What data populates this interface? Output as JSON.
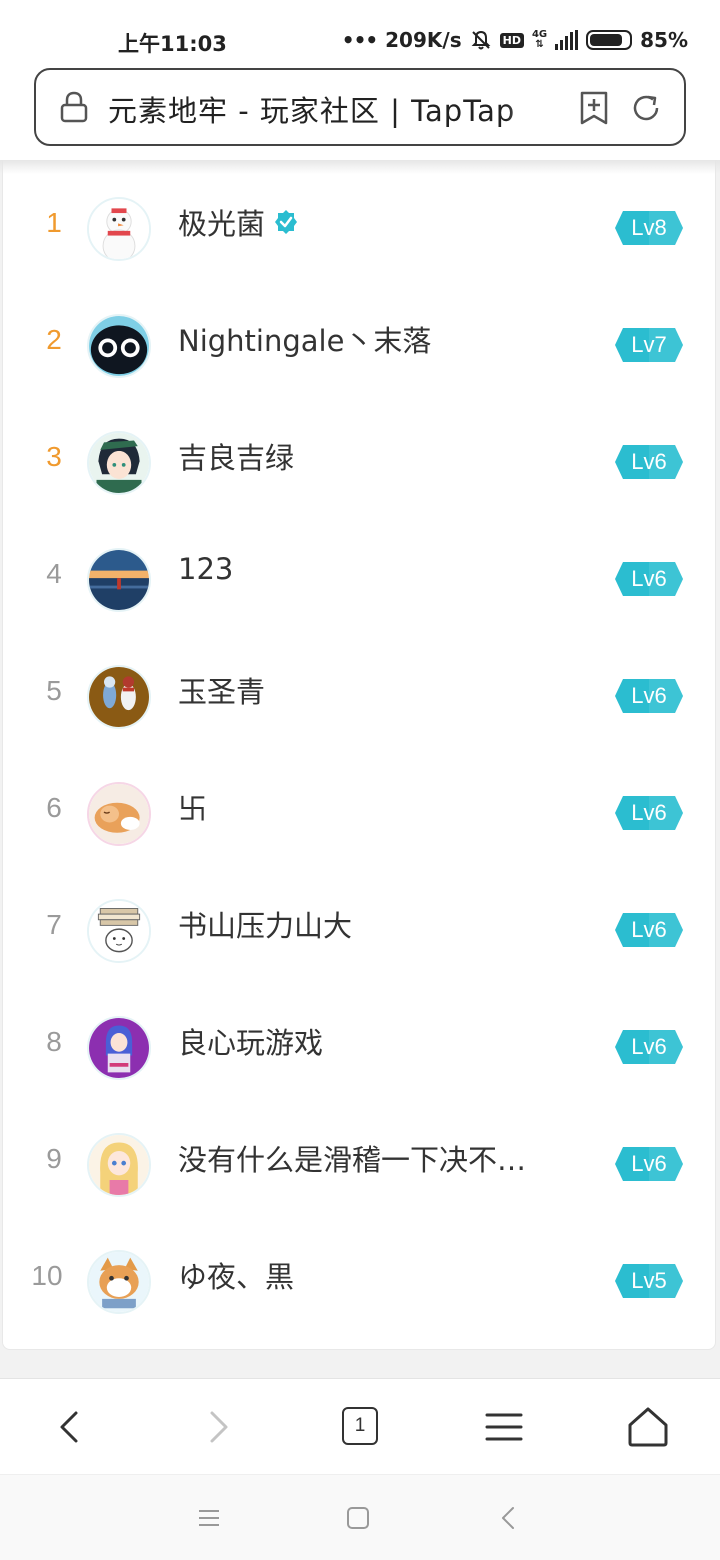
{
  "status_bar": {
    "time": "上午11:03",
    "net_speed": "209K/s",
    "hd_label": "HD",
    "network_type": "4G",
    "battery_percent": "85%",
    "battery_level": 0.85,
    "icons": [
      "signal-dots-icon",
      "mute-bell-icon",
      "hd-icon",
      "cell-signal-icon",
      "battery-icon"
    ]
  },
  "address_bar": {
    "url_text": "元素地牢 - 玩家社区 | TapTap",
    "icons": [
      "lock-icon",
      "bookmark-add-icon",
      "reload-icon"
    ]
  },
  "leaderboard": {
    "rows": [
      {
        "rank": "1",
        "name": "极光菌",
        "verified": true,
        "level": "Lv8",
        "top3": true,
        "avatar": "snowman-avatar"
      },
      {
        "rank": "2",
        "name": "Nightingale丶末落",
        "verified": false,
        "level": "Lv7",
        "top3": true,
        "avatar": "black-cat-avatar"
      },
      {
        "rank": "3",
        "name": "吉良吉绿",
        "verified": false,
        "level": "Lv6",
        "top3": true,
        "avatar": "anime-boy-avatar"
      },
      {
        "rank": "4",
        "name": "123",
        "verified": false,
        "level": "Lv6",
        "top3": false,
        "avatar": "sunset-sea-avatar"
      },
      {
        "rank": "5",
        "name": "玉圣青",
        "verified": false,
        "level": "Lv6",
        "top3": false,
        "avatar": "figures-avatar"
      },
      {
        "rank": "6",
        "name": "卐",
        "verified": false,
        "level": "Lv6",
        "top3": false,
        "avatar": "sleeping-cat-avatar"
      },
      {
        "rank": "7",
        "name": "书山压力山大",
        "verified": false,
        "level": "Lv6",
        "top3": false,
        "avatar": "books-avatar"
      },
      {
        "rank": "8",
        "name": "良心玩游戏",
        "verified": false,
        "level": "Lv6",
        "top3": false,
        "avatar": "purple-girl-avatar"
      },
      {
        "rank": "9",
        "name": "没有什么是滑稽一下决不…",
        "verified": false,
        "level": "Lv6",
        "top3": false,
        "avatar": "blonde-girl-avatar"
      },
      {
        "rank": "10",
        "name": "ゆ夜、黒",
        "verified": false,
        "level": "Lv5",
        "top3": false,
        "avatar": "shiba-dog-avatar"
      }
    ]
  },
  "browser_toolbar": {
    "tab_count": "1",
    "icons": [
      "back-icon",
      "forward-icon",
      "tabs-icon",
      "menu-icon",
      "home-icon"
    ]
  },
  "system_nav": {
    "icons": [
      "recents-icon",
      "home-square-icon",
      "system-back-icon"
    ]
  },
  "colors": {
    "rank_top": "#f09a2e",
    "rank_normal": "#9a9a9a",
    "level_badge": "#2bbdd0",
    "verified": "#2bbdd0"
  }
}
